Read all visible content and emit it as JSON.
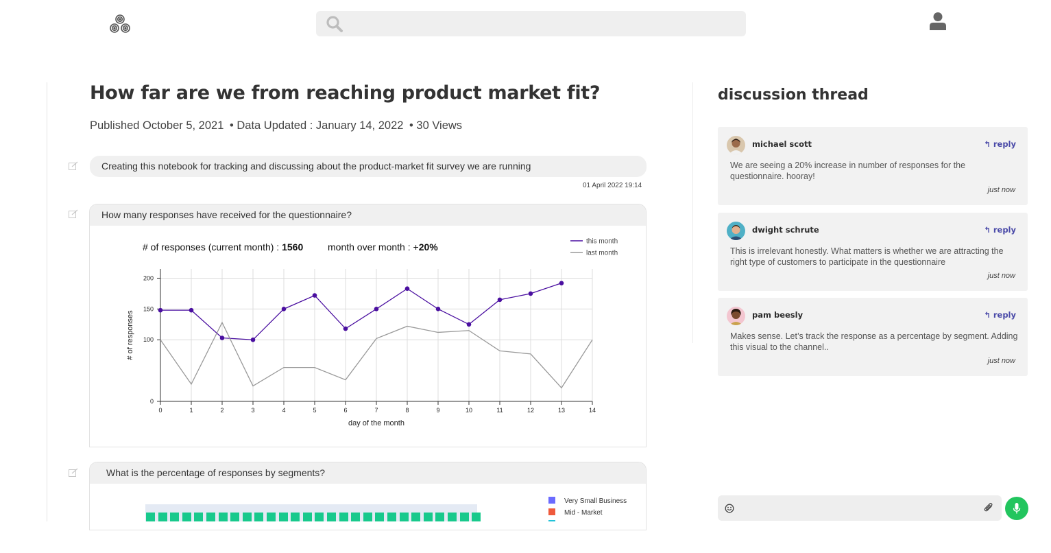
{
  "header": {
    "search_placeholder": "",
    "logo_icon": "triskele-logo-icon",
    "user_icon": "user-icon"
  },
  "notebook": {
    "title": "How far are we from reaching product market fit?",
    "published": "Published October 5, 2021",
    "updated": "• Data Updated : January 14, 2022",
    "views": "• 30 Views",
    "note_text": "Creating this notebook for tracking and discussing about the product-market fit survey we are running",
    "note_timestamp": "01 April 2022  19:14",
    "cell1": {
      "question": "How many responses have received for the questionnaire?",
      "kpi_label": "# of responses (current month) : ",
      "kpi_value": "1560",
      "mom_label": "month over month : +",
      "mom_value": "20%"
    },
    "cell2": {
      "question": "What is the percentage of responses by segments?",
      "legend": [
        {
          "label": "Very Small Business",
          "color": "#6b6bff"
        },
        {
          "label": "Mid - Market",
          "color": "#ef5a3c"
        }
      ]
    }
  },
  "chart_data": {
    "type": "line",
    "xlabel": "day of the month",
    "ylabel": "# of responses",
    "xlim": [
      0,
      14
    ],
    "x_ticks": [
      0,
      1,
      2,
      3,
      4,
      5,
      6,
      7,
      8,
      9,
      10,
      11,
      12,
      13,
      14
    ],
    "y_ticks": [
      0,
      100,
      150,
      200
    ],
    "grid": true,
    "legend_position": "top-right",
    "series": [
      {
        "name": "this month",
        "color": "#4a0fa0",
        "markers": true,
        "x": [
          0,
          1,
          2,
          3,
          4,
          5,
          6,
          7,
          8,
          9,
          10,
          11,
          12,
          13
        ],
        "y": [
          148,
          148,
          103,
          100,
          150,
          172,
          118,
          150,
          183,
          150,
          125,
          165,
          175,
          192
        ]
      },
      {
        "name": "last month",
        "color": "#999999",
        "markers": false,
        "x": [
          0,
          1,
          2,
          3,
          4,
          5,
          6,
          7,
          8,
          9,
          10,
          11,
          12,
          13,
          14
        ],
        "y": [
          100,
          28,
          128,
          25,
          55,
          55,
          35,
          102,
          122,
          112,
          115,
          82,
          77,
          22,
          100
        ]
      }
    ]
  },
  "segment_chart": {
    "bar_color": "#18c98c",
    "square_count": 28
  },
  "discussion": {
    "title": "discussion thread",
    "comments": [
      {
        "name": "michael scott",
        "reply": "reply",
        "body": "We are seeing a 20% increase in number of responses for the questionnaire. hooray!",
        "time": "just now"
      },
      {
        "name": "dwight schrute",
        "reply": "reply",
        "body": "This is irrelevant honestly. What matters is whether we are attracting the right type of customers to participate in the questionnaire",
        "time": "just now"
      },
      {
        "name": "pam beesly",
        "reply": "reply",
        "body": "Makes sense. Let’s track the response as a percentage by segment. Adding this visual to the channel..",
        "time": "just now"
      }
    ],
    "composer_placeholder": "",
    "emoji_icon": "smiley-icon",
    "attach_icon": "paperclip-icon",
    "mic_icon": "microphone-icon"
  },
  "colors": {
    "accent": "#4a0fa0",
    "reply": "#4a4aa8",
    "mic": "#22c55e"
  }
}
